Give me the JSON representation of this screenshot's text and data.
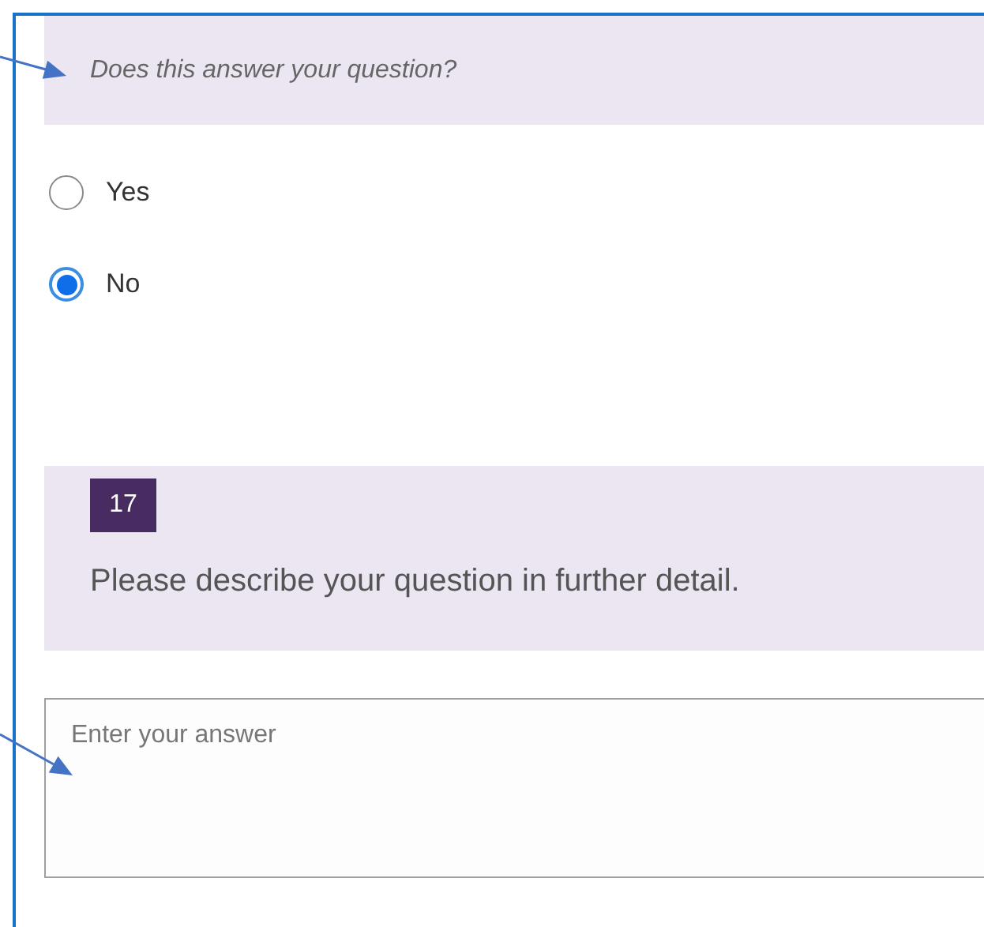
{
  "choice_question": {
    "prompt": "Does this answer your question?",
    "options": [
      {
        "label": "Yes",
        "selected": false
      },
      {
        "label": "No",
        "selected": true
      }
    ]
  },
  "text_question": {
    "number": "17",
    "prompt": "Please describe your question in further detail.",
    "answer": {
      "placeholder": "Enter your answer"
    }
  }
}
